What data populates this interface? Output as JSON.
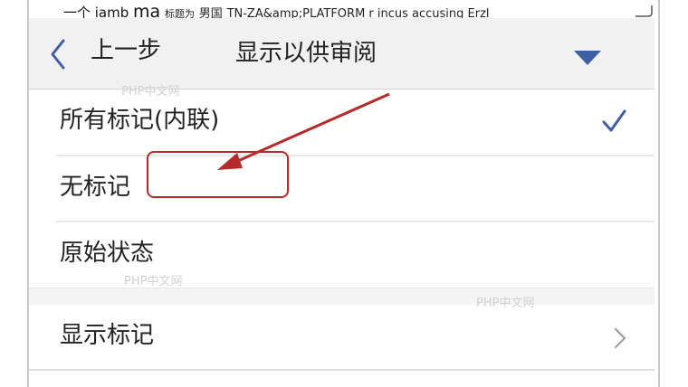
{
  "header_text": {
    "part1": "一个 iamb",
    "part2": "ma",
    "part3": "标题为",
    "part4": "男国",
    "part5": "TN-ZA&amp;PLATFORM r incus accusing Erzl"
  },
  "nav": {
    "back_label": "上一步",
    "title": "显示以供审阅"
  },
  "options": [
    {
      "label": "所有标记(内联)",
      "selected": true
    },
    {
      "label": "无标记",
      "selected": false
    },
    {
      "label": "原始状态",
      "selected": false
    }
  ],
  "show_markup": {
    "label": "显示标记"
  },
  "watermarks": [
    "PHP中文网",
    "PHP中文网",
    "PHP中文网"
  ],
  "colors": {
    "accent": "#3f5fa3",
    "annotation": "#b52a2a",
    "navbar_bg": "#f1f1f1"
  },
  "icons": [
    "back-chevron-icon",
    "dropdown-triangle-icon",
    "checkmark-icon",
    "chevron-right-icon",
    "corner-arrow-icon"
  ]
}
